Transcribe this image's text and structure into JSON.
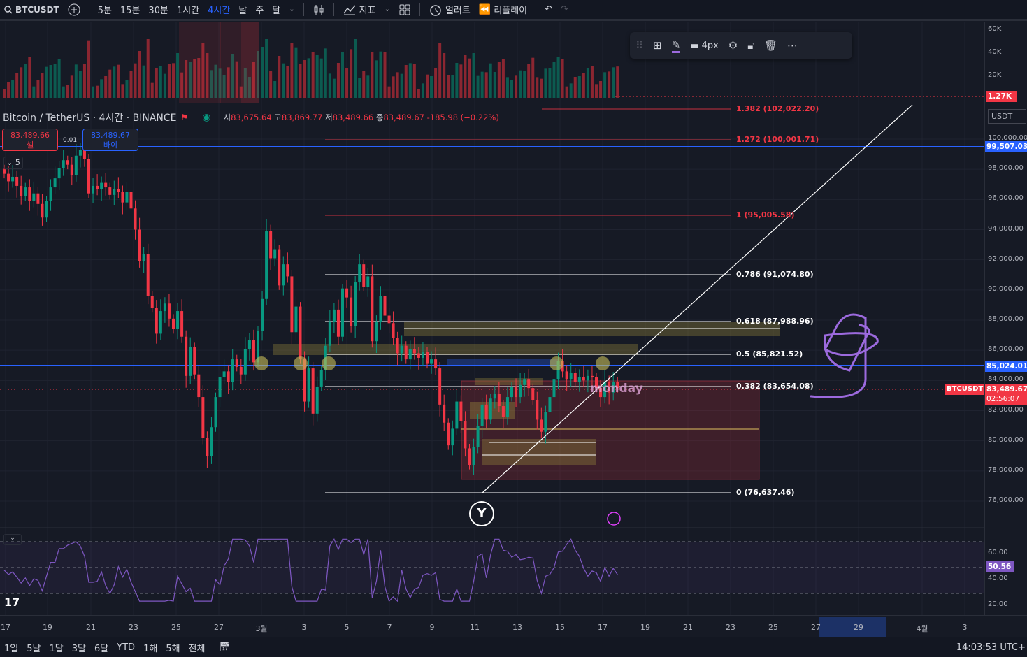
{
  "topbar": {
    "symbol": "BTCUSDT",
    "intervals": [
      "5분",
      "15분",
      "30분",
      "1시간",
      "4시간",
      "날",
      "주",
      "달"
    ],
    "active_interval": "4시간",
    "indicators": "지표",
    "alert": "얼러트",
    "replay": "리플레이"
  },
  "legend": {
    "title": "Bitcoin / TetherUS · 4시간 · BINANCE",
    "o_label": "시",
    "o": "83,675.64",
    "h_label": "고",
    "h": "83,869.77",
    "l_label": "저",
    "l": "83,489.66",
    "c_label": "종",
    "c": "83,489.67",
    "change": "-185.98 (−0.22%)"
  },
  "trade": {
    "sell_price": "83,489.66",
    "sell_label": "셀",
    "buy_price": "83,489.67",
    "buy_label": "바이",
    "spread": "0.01"
  },
  "collapse_count": "5",
  "draw_toolbar": {
    "width_label": "4px"
  },
  "volume_axis": [
    "60K",
    "40K",
    "20K"
  ],
  "volume_last": "1.27K",
  "currency": "USDT",
  "price_axis": [
    "100,000.00",
    "98,000.00",
    "96,000.00",
    "94,000.00",
    "92,000.00",
    "90,000.00",
    "88,000.00",
    "86,000.00",
    "84,000.00",
    "82,000.00",
    "80,000.00",
    "78,000.00",
    "76,000.00"
  ],
  "price_tags": {
    "blue_high": "99,507.03",
    "blue_mid": "85,024.01",
    "symbol": "BTCUSDT",
    "last": "83,489.67",
    "countdown": "02:56:07"
  },
  "fib_levels": [
    {
      "label": "1.382 (102,022.20)",
      "color": "#f23645"
    },
    {
      "label": "1.272 (100,001.71)",
      "color": "#f23645"
    },
    {
      "label": "1 (95,005.58)",
      "color": "#f23645"
    },
    {
      "label": "0.786 (91,074.80)",
      "color": "#ffffff"
    },
    {
      "label": "0.618 (87,988.96)",
      "color": "#ffffff"
    },
    {
      "label": "0.5 (85,821.52)",
      "color": "#ffffff"
    },
    {
      "label": "0.382 (83,654.08)",
      "color": "#ffffff"
    },
    {
      "label": "0 (76,637.46)",
      "color": "#ffffff"
    }
  ],
  "annotations": {
    "y_marker": "Y",
    "monday": "monday"
  },
  "rsi": {
    "axis": [
      "60.00",
      "40.00",
      "20.00"
    ],
    "value": "50.56"
  },
  "time_axis": [
    "17",
    "19",
    "21",
    "23",
    "25",
    "27",
    "3월",
    "3",
    "5",
    "7",
    "9",
    "11",
    "13",
    "15",
    "17",
    "19",
    "21",
    "23",
    "25",
    "27",
    "29",
    "4월",
    "3"
  ],
  "bottom": {
    "ranges": [
      "1일",
      "5날",
      "1달",
      "3달",
      "6달",
      "YTD",
      "1해",
      "5해",
      "전체"
    ],
    "clock": "14:03:53 UTC+"
  },
  "colors": {
    "up": "#089981",
    "down": "#f23645",
    "blue": "#2962ff",
    "purple": "#7e57c2",
    "bg": "#161a25"
  },
  "chart_data": {
    "type": "candlestick",
    "symbol": "BTCUSDT",
    "interval": "4h",
    "ylim": [
      75500,
      101000
    ],
    "points": [
      [
        98000,
        97700
      ],
      [
        97700,
        97200
      ],
      [
        97200,
        97500
      ],
      [
        97500,
        96900
      ],
      [
        96900,
        96200
      ],
      [
        96200,
        96800
      ],
      [
        96800,
        95900
      ],
      [
        95900,
        96400
      ],
      [
        96400,
        95700
      ],
      [
        95700,
        94800
      ],
      [
        94800,
        95900
      ],
      [
        95900,
        96800
      ],
      [
        96800,
        97400
      ],
      [
        97400,
        98100
      ],
      [
        98100,
        98600
      ],
      [
        98600,
        98300
      ],
      [
        98300,
        97600
      ],
      [
        97600,
        98900
      ],
      [
        98900,
        99300
      ],
      [
        99300,
        98700
      ],
      [
        98700,
        96400
      ],
      [
        96400,
        96900
      ],
      [
        96900,
        96700
      ],
      [
        96700,
        97100
      ],
      [
        97100,
        96800
      ],
      [
        96800,
        96300
      ],
      [
        96300,
        96700
      ],
      [
        96700,
        96500
      ],
      [
        96500,
        95800
      ],
      [
        95800,
        96500
      ],
      [
        96500,
        95400
      ],
      [
        95400,
        94000
      ],
      [
        94000,
        91900
      ],
      [
        91900,
        92400
      ],
      [
        92400,
        89600
      ],
      [
        89600,
        88800
      ],
      [
        88800,
        87100
      ],
      [
        87100,
        88600
      ],
      [
        88600,
        89100
      ],
      [
        89100,
        88100
      ],
      [
        88100,
        87400
      ],
      [
        87400,
        88600
      ],
      [
        88600,
        86900
      ],
      [
        86900,
        84300
      ],
      [
        84300,
        86200
      ],
      [
        86200,
        84400
      ],
      [
        84400,
        82900
      ],
      [
        82900,
        80200
      ],
      [
        80200,
        79000
      ],
      [
        79000,
        80900
      ],
      [
        80900,
        82900
      ],
      [
        82900,
        84200
      ],
      [
        84200,
        84600
      ],
      [
        84600,
        83900
      ],
      [
        83900,
        85400
      ],
      [
        85400,
        84900
      ],
      [
        84900,
        84400
      ],
      [
        84400,
        86100
      ],
      [
        86100,
        86700
      ],
      [
        86700,
        85200
      ],
      [
        85200,
        87300
      ],
      [
        87300,
        89400
      ],
      [
        89400,
        93900
      ],
      [
        93900,
        92100
      ],
      [
        92100,
        92700
      ],
      [
        92700,
        90300
      ],
      [
        90300,
        91700
      ],
      [
        91700,
        90900
      ],
      [
        90900,
        87200
      ],
      [
        87200,
        88900
      ],
      [
        88900,
        85400
      ],
      [
        85400,
        82600
      ],
      [
        82600,
        84800
      ],
      [
        84800,
        81800
      ],
      [
        81800,
        83600
      ],
      [
        83600,
        84700
      ],
      [
        84700,
        86300
      ],
      [
        86300,
        87900
      ],
      [
        87900,
        88700
      ],
      [
        88700,
        86900
      ],
      [
        86900,
        90100
      ],
      [
        90100,
        89500
      ],
      [
        89500,
        87600
      ],
      [
        87600,
        90500
      ],
      [
        90500,
        91700
      ],
      [
        91700,
        90200
      ],
      [
        90200,
        90900
      ],
      [
        90900,
        86600
      ],
      [
        86600,
        87900
      ],
      [
        87900,
        89600
      ],
      [
        89600,
        88300
      ],
      [
        88300,
        87800
      ],
      [
        87800,
        86800
      ],
      [
        86800,
        85800
      ],
      [
        85800,
        86300
      ],
      [
        86300,
        85400
      ],
      [
        85400,
        86100
      ],
      [
        86100,
        85800
      ],
      [
        85800,
        85500
      ],
      [
        85500,
        85900
      ],
      [
        85900,
        85100
      ],
      [
        85100,
        85400
      ],
      [
        85400,
        84800
      ],
      [
        84800,
        82400
      ],
      [
        82400,
        81200
      ],
      [
        81200,
        79700
      ],
      [
        79700,
        80800
      ],
      [
        80800,
        82600
      ],
      [
        82600,
        81300
      ],
      [
        81300,
        79500
      ],
      [
        79500,
        78400
      ],
      [
        78400,
        79600
      ],
      [
        79600,
        81000
      ],
      [
        81000,
        82400
      ],
      [
        82400,
        81400
      ],
      [
        81400,
        82800
      ],
      [
        82800,
        83100
      ],
      [
        83100,
        82300
      ],
      [
        82300,
        81600
      ],
      [
        81600,
        82900
      ],
      [
        82900,
        83600
      ],
      [
        83600,
        82900
      ],
      [
        82900,
        83700
      ],
      [
        83700,
        84100
      ],
      [
        84100,
        83500
      ],
      [
        83500,
        82700
      ],
      [
        82700,
        81400
      ],
      [
        81400,
        80600
      ],
      [
        80600,
        81900
      ],
      [
        81900,
        82900
      ],
      [
        82900,
        84100
      ],
      [
        84100,
        85300
      ],
      [
        85300,
        84600
      ],
      [
        84600,
        84100
      ],
      [
        84100,
        84500
      ],
      [
        84500,
        83900
      ],
      [
        83900,
        84200
      ],
      [
        84200,
        84000
      ],
      [
        84000,
        84300
      ],
      [
        84300,
        84200
      ],
      [
        84200,
        83500
      ],
      [
        83500,
        82900
      ],
      [
        82900,
        83900
      ],
      [
        83900,
        83200
      ],
      [
        83200,
        83900
      ],
      [
        83900,
        83490
      ]
    ]
  }
}
